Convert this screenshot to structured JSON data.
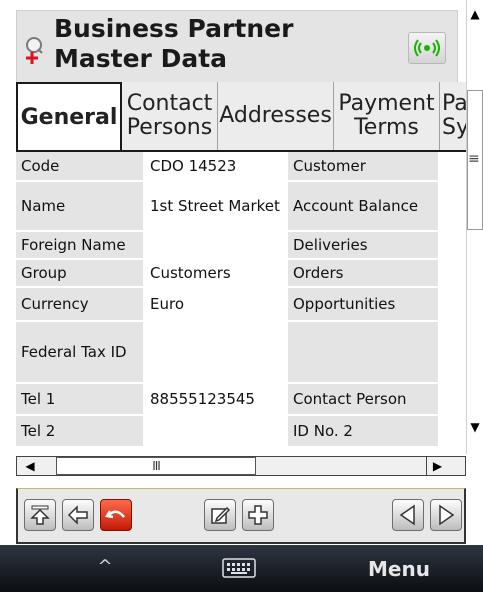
{
  "window": {
    "title": "Business Partner Master Data"
  },
  "tabs": [
    {
      "label": "General",
      "active": true
    },
    {
      "label": "Contact Persons",
      "active": false
    },
    {
      "label": "Addresses",
      "active": false
    },
    {
      "label": "Payment Terms",
      "active": false
    },
    {
      "label": "Pa Sy",
      "active": false
    }
  ],
  "table": {
    "rows": [
      {
        "label": "Code",
        "value": "CDO 14523",
        "label2": "Customer"
      },
      {
        "label": "Name",
        "value": "1st Street Market",
        "label2": "Account Balance"
      },
      {
        "label": "Foreign Name",
        "value": "",
        "label2": "Deliveries"
      },
      {
        "label": "Group",
        "value": "Customers",
        "label2": "Orders"
      },
      {
        "label": "Currency",
        "value": "Euro",
        "label2": "Opportunities"
      },
      {
        "label": "Federal Tax ID",
        "value": "",
        "label2": ""
      },
      {
        "label": "Tel 1",
        "value": "88555123545",
        "label2": "Contact Person"
      },
      {
        "label": "Tel 2",
        "value": "",
        "label2": "ID No. 2"
      }
    ]
  },
  "hscroll": {
    "thumb_grip": "III",
    "left_arrow": "◀",
    "right_arrow": "▶"
  },
  "vscroll": {
    "up_arrow": "▲",
    "down_arrow": "▼",
    "grip": "≡"
  },
  "toolbar": {
    "icons": [
      "go-top-icon",
      "back-icon",
      "undo-icon",
      "edit-icon",
      "add-icon",
      "previous-icon",
      "next-icon"
    ]
  },
  "bottom_bar": {
    "up_label": "^",
    "keyboard_icon": "keyboard-icon",
    "menu_label": "Menu"
  },
  "colors": {
    "panel_gray": "#e4e4e4",
    "undo_red": "#e03a1e",
    "signal_green": "#19b400",
    "bottom_bar": "#1a1f26"
  }
}
